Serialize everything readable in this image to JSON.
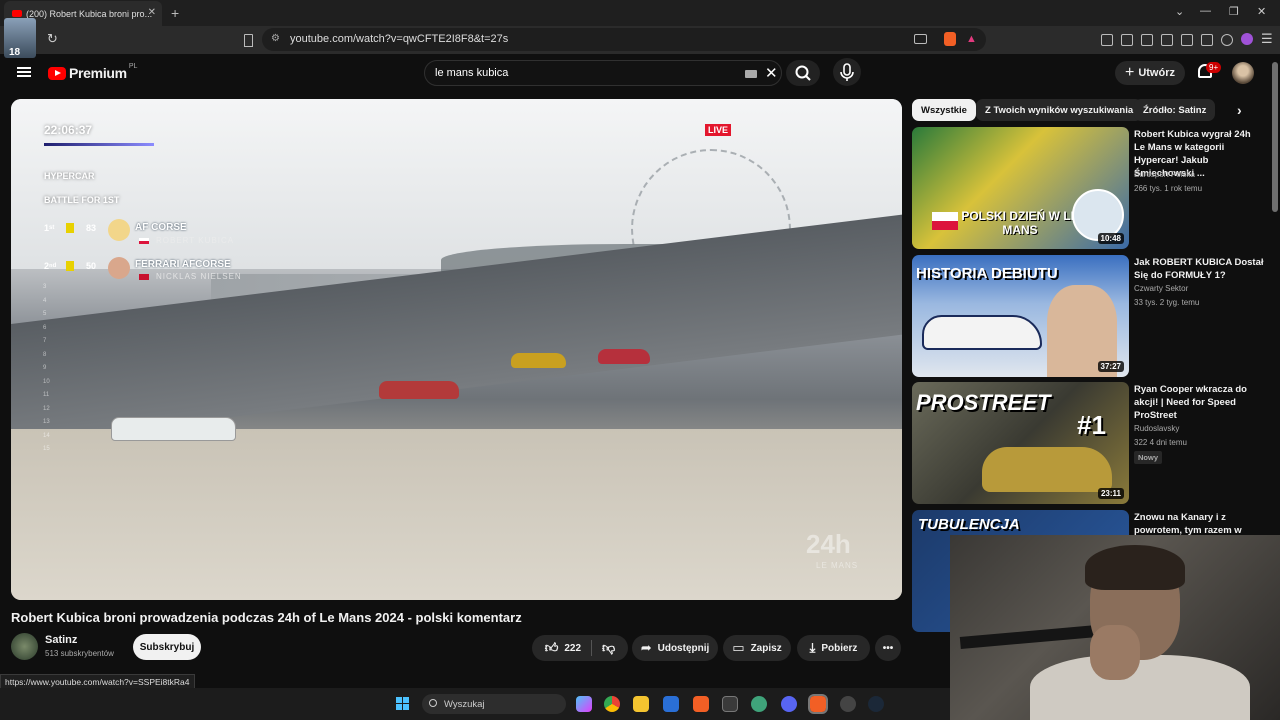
{
  "browser": {
    "tab_title": "(200) Robert Kubica broni pro...",
    "new_tab": "+",
    "url": "youtube.com/watch?v=qwCFTE2I8F8&t=27s",
    "avatar_label": "18",
    "status_url": "https://www.youtube.com/watch?v=SSPEi8tkRa4"
  },
  "header": {
    "logo_text": "Premium",
    "logo_region": "PL",
    "search_value": "le mans kubica",
    "create_label": "Utwórz",
    "notif_count": "9+"
  },
  "player": {
    "clock": "22:06:37",
    "class_label": "HYPERCAR",
    "battle_label": "BATTLE FOR 1ST",
    "rows": [
      {
        "pos": "1ˢᵗ",
        "num": "83",
        "team": "AF CORSE",
        "driver": "ROBERT KUBICA"
      },
      {
        "pos": "2ⁿᵈ",
        "num": "50",
        "team": "FERRARI AFCORSE",
        "driver": "NICKLAS NIELSEN"
      }
    ],
    "live": "LIVE",
    "watermark": "24h",
    "watermark_sub": "LE MANS",
    "left_positions": [
      "3",
      "4",
      "5",
      "6",
      "7",
      "8",
      "9",
      "10",
      "11",
      "12",
      "13",
      "14",
      "15"
    ]
  },
  "video": {
    "title": "Robert Kubica broni prowadzenia podczas 24h of Le Mans 2024 - polski komentarz",
    "channel": "Satinz",
    "subs": "513 subskrybentów",
    "subscribe": "Subskrybuj",
    "likes": "222",
    "share": "Udostępnij",
    "save": "Zapisz",
    "download": "Pobierz"
  },
  "chips": [
    "Wszystkie",
    "Z Twoich wyników wyszukiwania",
    "Źródło: Satinz"
  ],
  "recommendations": [
    {
      "title": "Robert Kubica wygrał 24h Le Mans w kategorii Hypercar! Jakub Śmiechowski ...",
      "channel": "Eurosport Polska",
      "meta": "266 tys.   1 rok temu",
      "duration": "10:48",
      "thumb_text": "POLSKI DZIEŃ W LE MANS"
    },
    {
      "title": "Jak ROBERT KUBICA Dostał Się do FORMUŁY 1?",
      "channel": "Czwarty Sektor",
      "meta": "33 tys.   2 tyg. temu",
      "duration": "37:27",
      "thumb_text": "HISTORIA DEBIUTU"
    },
    {
      "title": "Ryan Cooper wkracza do akcji! | Need for Speed ProStreet",
      "channel": "Rudoslavsky",
      "meta": "322   4 dni temu",
      "duration": "23:11",
      "thumb_text": "PROSTREET",
      "thumb_sub": "#1",
      "badge": "Nowy"
    },
    {
      "title": "Znowu na Kanary i z powrotem, tym razem w",
      "thumb_text": "TUBULENCJA"
    }
  ],
  "taskbar": {
    "search_placeholder": "Wyszukaj"
  }
}
